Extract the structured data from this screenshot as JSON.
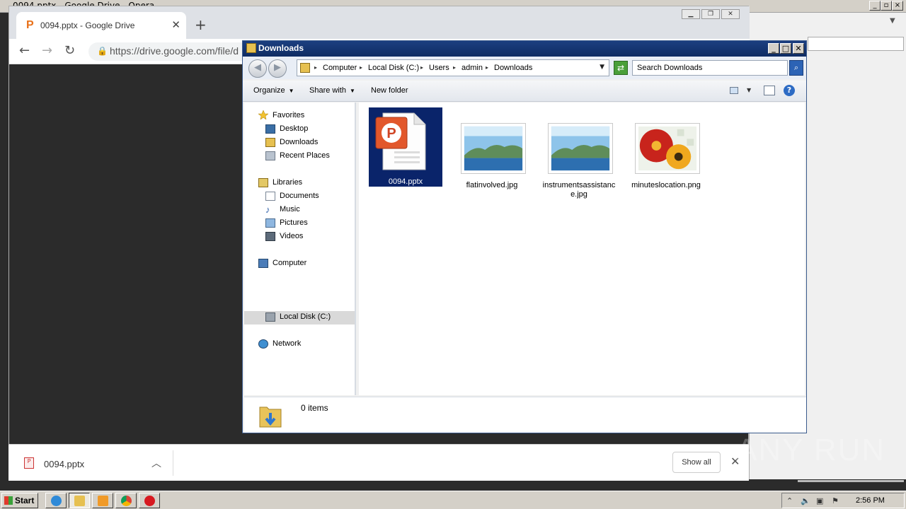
{
  "outer_window": {
    "title": "0094.pptx - Google Drive - Opera"
  },
  "browser": {
    "tab_title": "0094.pptx - Google Drive",
    "url": "https://drive.google.com/file/d",
    "download_shelf": {
      "file_name": "0094.pptx",
      "show_all_label": "Show all"
    }
  },
  "explorer": {
    "title": "Downloads",
    "breadcrumbs": [
      "Computer",
      "Local Disk (C:)",
      "Users",
      "admin",
      "Downloads"
    ],
    "search_placeholder": "Search Downloads",
    "commands": {
      "organize": "Organize",
      "share_with": "Share with",
      "new_folder": "New folder"
    },
    "nav": {
      "favorites": "Favorites",
      "desktop": "Desktop",
      "downloads": "Downloads",
      "recent_places": "Recent Places",
      "libraries": "Libraries",
      "documents": "Documents",
      "music": "Music",
      "pictures": "Pictures",
      "videos": "Videos",
      "computer": "Computer",
      "local_disk": "Local Disk (C:)",
      "network": "Network"
    },
    "files": [
      {
        "name": "0094.pptx",
        "type": "pptx",
        "selected": true
      },
      {
        "name": "flatinvolved.jpg",
        "type": "jpg",
        "selected": false
      },
      {
        "name": "instrumentsassistance.jpg",
        "type": "jpg",
        "selected": false
      },
      {
        "name": "minuteslocation.png",
        "type": "png",
        "selected": false
      }
    ],
    "status": "0 items"
  },
  "watermark": "ANY RUN",
  "taskbar": {
    "start_label": "Start",
    "clock": "2:56 PM"
  },
  "colors": {
    "selection": "#0a246a",
    "titlebar": "#1c3f80",
    "pptx_orange": "#e8711a"
  }
}
